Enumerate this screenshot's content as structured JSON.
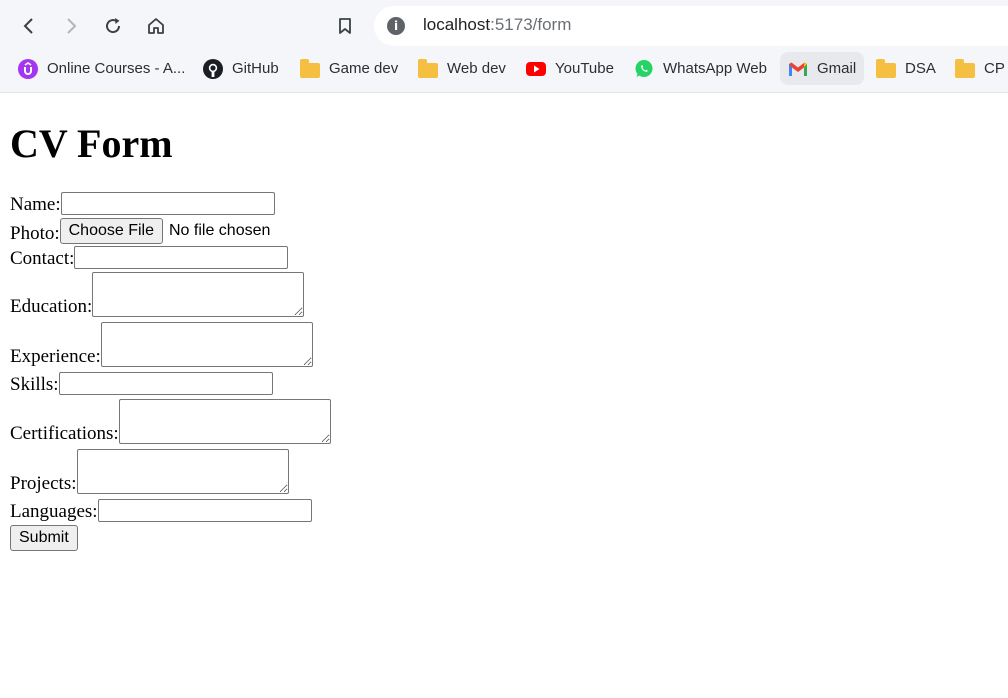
{
  "browser": {
    "url_host": "localhost",
    "url_rest": ":5173/form",
    "bookmarks": [
      {
        "label": "Online Courses - A...",
        "icon": "udemy-icon"
      },
      {
        "label": "GitHub",
        "icon": "github-icon"
      },
      {
        "label": "Game dev",
        "icon": "folder-icon"
      },
      {
        "label": "Web dev",
        "icon": "folder-icon"
      },
      {
        "label": "YouTube",
        "icon": "youtube-icon"
      },
      {
        "label": "WhatsApp Web",
        "icon": "whatsapp-icon"
      },
      {
        "label": "Gmail",
        "icon": "gmail-icon"
      },
      {
        "label": "DSA",
        "icon": "folder-icon"
      },
      {
        "label": "CP",
        "icon": "folder-icon"
      }
    ]
  },
  "form": {
    "title": "CV Form",
    "name_label": "Name:",
    "name_value": "",
    "photo_label": "Photo:",
    "choose_file_label": "Choose File",
    "no_file_text": "No file chosen",
    "contact_label": "Contact:",
    "contact_value": "",
    "education_label": "Education:",
    "experience_label": "Experience:",
    "skills_label": "Skills:",
    "skills_value": "",
    "certifications_label": "Certifications:",
    "projects_label": "Projects:",
    "languages_label": "Languages:",
    "languages_value": "",
    "submit_label": "Submit"
  }
}
